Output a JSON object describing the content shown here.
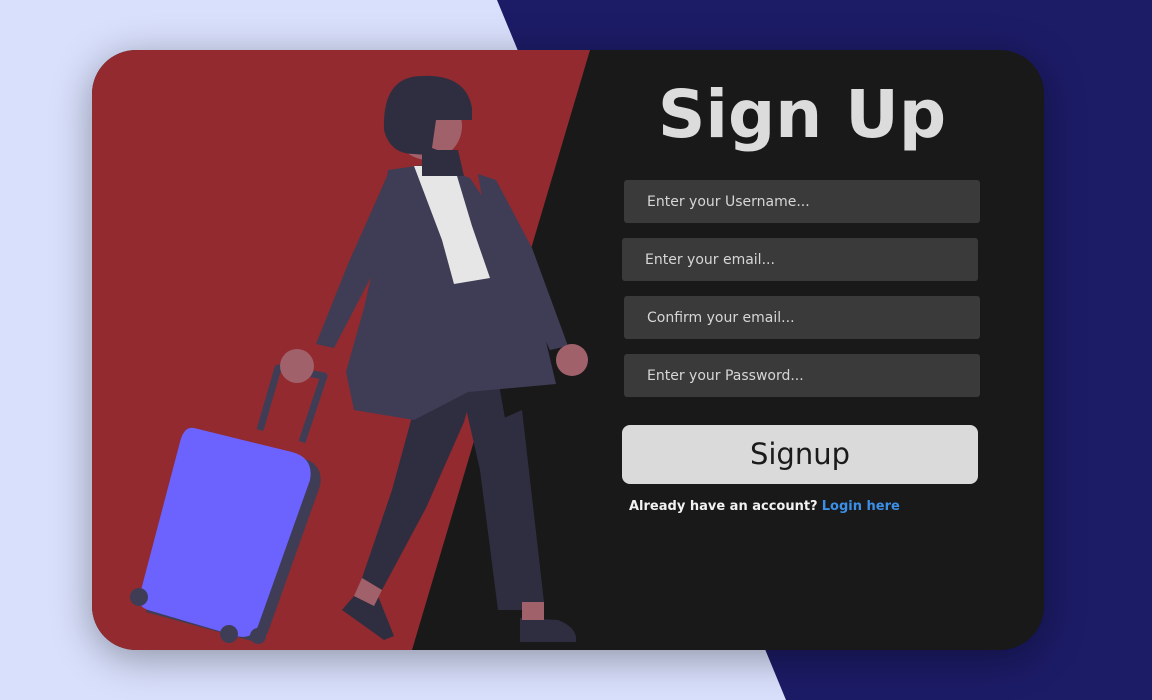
{
  "colors": {
    "page_background": "#d9e0fc",
    "navy_stripe": "#1c1b66",
    "card_background": "#191919",
    "red_panel": "#922a2f",
    "input_background": "#3a3a3a",
    "button_background": "#dadada",
    "link": "#3b8fe8",
    "suitcase": "#6c63ff"
  },
  "illustration": {
    "subject": "woman-with-suitcase"
  },
  "form": {
    "title": "Sign Up",
    "username_placeholder": "Enter your Username...",
    "email_placeholder": "Enter your email...",
    "confirm_email_placeholder": "Confirm your email...",
    "password_placeholder": "Enter your Password...",
    "submit_label": "Signup",
    "account_prompt": "Already have an account?",
    "login_link": "Login here"
  }
}
